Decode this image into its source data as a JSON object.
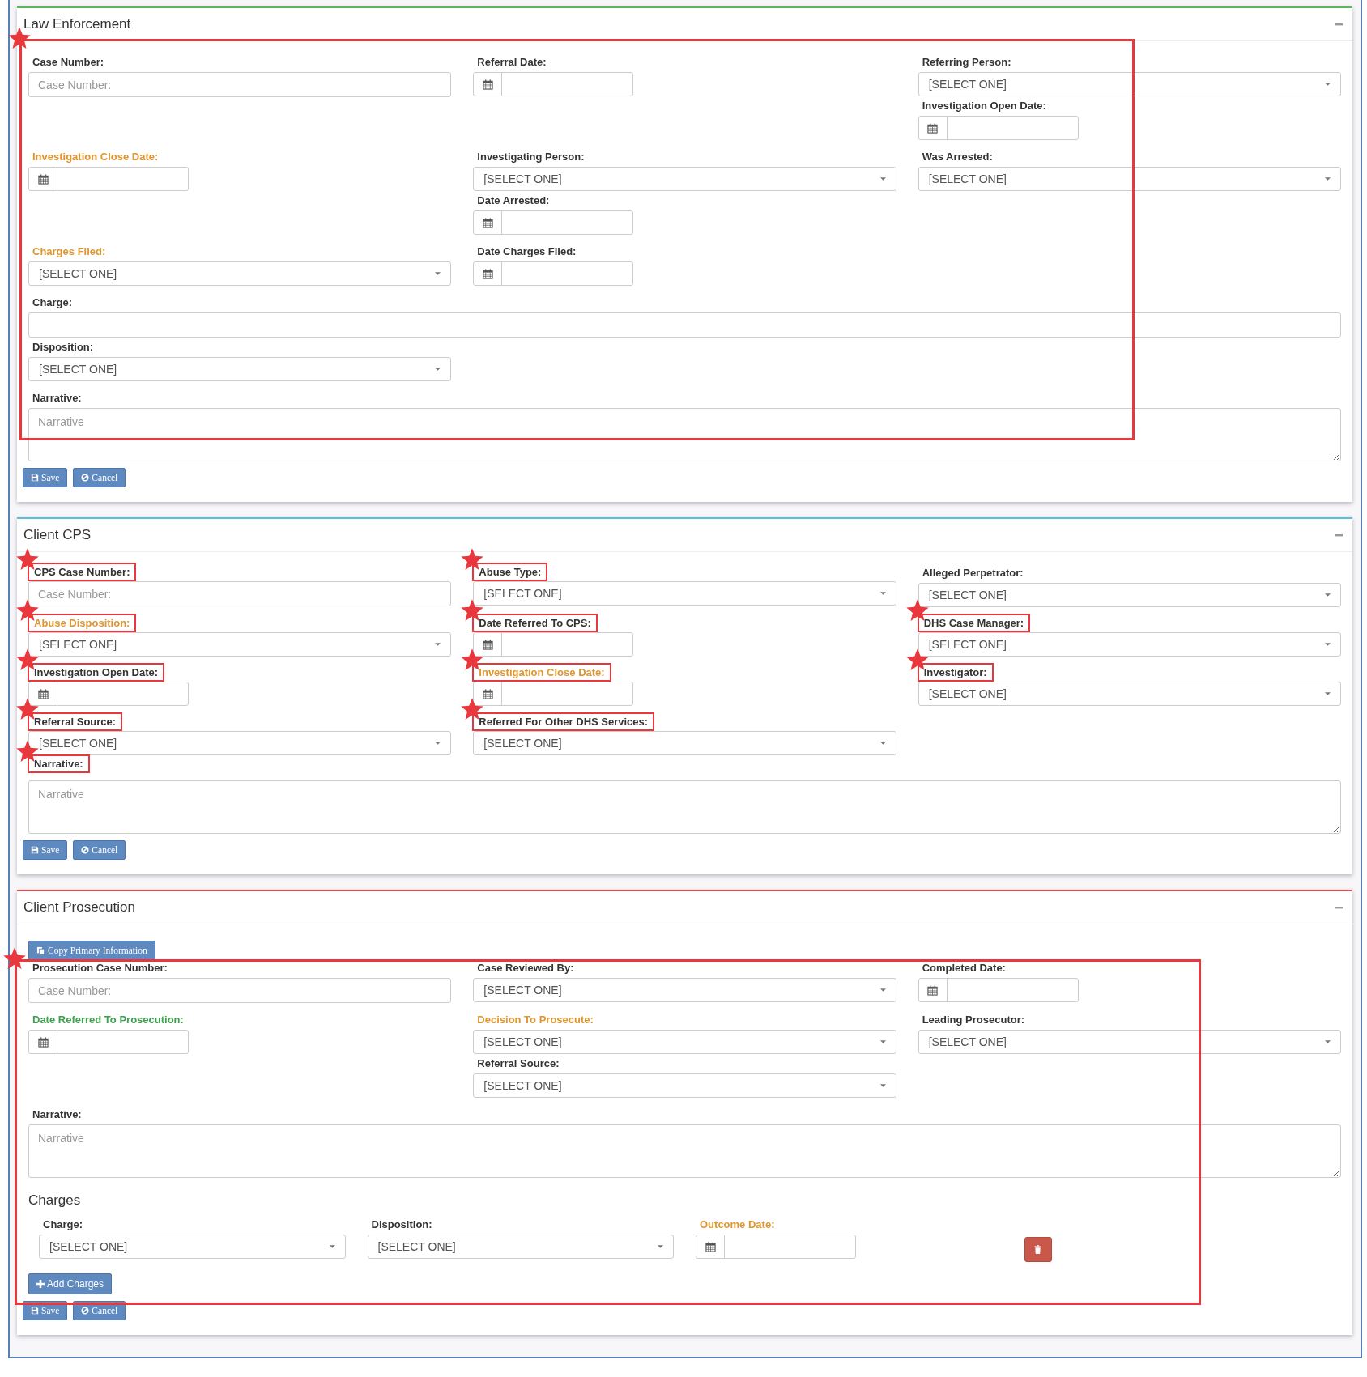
{
  "sections": [
    {
      "title": "Law Enforcement",
      "color": "#5cb85c",
      "annotation_box": true,
      "rows": [
        {
          "kind": "thirds",
          "columns": [
            [
              {
                "label": "Case Number:",
                "kind": "text",
                "placeholder": "Case Number:",
                "color": "#333333"
              }
            ],
            [
              {
                "label": "Referral Date:",
                "kind": "date",
                "color": "#333333"
              }
            ],
            [
              {
                "label": "Referring Person:",
                "kind": "select",
                "value": "[SELECT ONE]",
                "color": "#333333"
              },
              {
                "label": "Investigation Open Date:",
                "kind": "date",
                "color": "#333333"
              }
            ]
          ]
        },
        {
          "kind": "thirds",
          "columns": [
            [
              {
                "label": "Investigation Close Date:",
                "kind": "date",
                "color": "#e0962e"
              }
            ],
            [
              {
                "label": "Investigating Person:",
                "kind": "select",
                "value": "[SELECT ONE]",
                "color": "#333333"
              },
              {
                "label": "Date Arrested:",
                "kind": "date",
                "color": "#333333"
              }
            ],
            [
              {
                "label": "Was Arrested:",
                "kind": "select",
                "value": "[SELECT ONE]",
                "color": "#333333"
              }
            ]
          ]
        },
        {
          "kind": "thirds",
          "columns": [
            [
              {
                "label": "Charges Filed:",
                "kind": "select",
                "value": "[SELECT ONE]",
                "color": "#e0962e"
              }
            ],
            [
              {
                "label": "Date Charges Filed:",
                "kind": "date",
                "color": "#333333"
              }
            ]
          ]
        },
        {
          "kind": "full",
          "columns": [
            [
              {
                "label": "Charge:",
                "kind": "text",
                "color": "#333333"
              }
            ]
          ]
        },
        {
          "kind": "thirds",
          "columns": [
            [
              {
                "label": "Disposition:",
                "kind": "select",
                "value": "[SELECT ONE]",
                "color": "#333333"
              }
            ]
          ]
        },
        {
          "kind": "full",
          "columns": [
            [
              {
                "label": "Narrative:",
                "kind": "textarea",
                "placeholder": "Narrative",
                "color": "#333333"
              }
            ]
          ]
        }
      ],
      "buttons": [
        {
          "label": "Save",
          "kind": "save"
        },
        {
          "label": "Cancel",
          "kind": "cancel"
        }
      ]
    },
    {
      "title": "Client CPS",
      "color": "#5bc0de",
      "rows": [
        {
          "kind": "thirds",
          "columns": [
            [
              {
                "label": "CPS Case Number:",
                "kind": "text",
                "placeholder": "Case Number:",
                "color": "#333333",
                "annotated": true
              }
            ],
            [
              {
                "label": "Abuse Type:",
                "kind": "select",
                "value": "[SELECT ONE]",
                "color": "#333333",
                "annotated": true
              }
            ],
            [
              {
                "label": "Alleged Perpetrator:",
                "kind": "select",
                "value": "[SELECT ONE]",
                "color": "#333333",
                "annotated": false
              }
            ]
          ]
        },
        {
          "kind": "thirds",
          "columns": [
            [
              {
                "label": "Abuse Disposition:",
                "kind": "select",
                "value": "[SELECT ONE]",
                "color": "#e0962e",
                "annotated": true
              }
            ],
            [
              {
                "label": "Date Referred To CPS:",
                "kind": "date",
                "color": "#333333",
                "annotated": true
              }
            ],
            [
              {
                "label": "DHS Case Manager:",
                "kind": "select",
                "value": "[SELECT ONE]",
                "color": "#333333",
                "annotated": true
              }
            ]
          ]
        },
        {
          "kind": "thirds",
          "columns": [
            [
              {
                "label": "Investigation Open Date:",
                "kind": "date",
                "color": "#333333",
                "annotated": true
              }
            ],
            [
              {
                "label": "Investigation Close Date:",
                "kind": "date",
                "color": "#e0962e",
                "annotated": true
              }
            ],
            [
              {
                "label": "Investigator:",
                "kind": "select",
                "value": "[SELECT ONE]",
                "color": "#333333",
                "annotated": true
              }
            ]
          ]
        },
        {
          "kind": "thirds",
          "columns": [
            [
              {
                "label": "Referral Source:",
                "kind": "select",
                "value": "[SELECT ONE]",
                "color": "#333333",
                "annotated": true
              },
              {
                "label": "Narrative:",
                "kind": "none",
                "color": "#333333",
                "annotated": true
              }
            ],
            [
              {
                "label": "Referred For Other DHS Services:",
                "kind": "select",
                "value": "[SELECT ONE]",
                "color": "#333333",
                "annotated": true
              }
            ]
          ]
        },
        {
          "kind": "full",
          "columns": [
            [
              {
                "kind": "textarea",
                "placeholder": "Narrative",
                "annotated": false
              }
            ]
          ]
        }
      ],
      "buttons": [
        {
          "label": "Save",
          "kind": "save"
        },
        {
          "label": "Cancel",
          "kind": "cancel"
        }
      ]
    },
    {
      "title": "Client Prosecution",
      "color": "#d9534f",
      "annotation_box": true,
      "copy_button": "Copy Primary Information",
      "rows": [
        {
          "kind": "thirds",
          "columns": [
            [
              {
                "label": "Prosecution Case Number:",
                "kind": "text",
                "placeholder": "Case Number:",
                "color": "#333333"
              }
            ],
            [
              {
                "label": "Case Reviewed By:",
                "kind": "select",
                "value": "[SELECT ONE]",
                "color": "#333333"
              }
            ],
            [
              {
                "label": "Completed Date:",
                "kind": "date",
                "color": "#333333"
              }
            ]
          ]
        },
        {
          "kind": "thirds",
          "columns": [
            [
              {
                "label": "Date Referred To Prosecution:",
                "kind": "date",
                "color": "#3ea04f"
              }
            ],
            [
              {
                "label": "Decision To Prosecute:",
                "kind": "select",
                "value": "[SELECT ONE]",
                "color": "#e0962e"
              },
              {
                "label": "Referral Source:",
                "kind": "select",
                "value": "[SELECT ONE]",
                "color": "#333333"
              }
            ],
            [
              {
                "label": "Leading Prosecutor:",
                "kind": "select",
                "value": "[SELECT ONE]",
                "color": "#333333"
              }
            ]
          ]
        },
        {
          "kind": "full",
          "columns": [
            [
              {
                "label": "Narrative:",
                "kind": "textarea",
                "placeholder": "Narrative",
                "color": "#333333"
              }
            ]
          ]
        }
      ],
      "charges": {
        "title": "Charges",
        "rows": [
          {
            "fields": [
              {
                "label": "Charge:",
                "kind": "select",
                "value": "[SELECT ONE]",
                "color": "#333333"
              },
              {
                "label": "Disposition:",
                "kind": "select",
                "value": "[SELECT ONE]",
                "color": "#333333"
              },
              {
                "label": "Outcome Date:",
                "kind": "date",
                "color": "#e0962e"
              }
            ]
          }
        ],
        "add_button": "Add Charges"
      },
      "buttons": [
        {
          "label": "Save",
          "kind": "save"
        },
        {
          "label": "Cancel",
          "kind": "cancel"
        }
      ]
    }
  ]
}
